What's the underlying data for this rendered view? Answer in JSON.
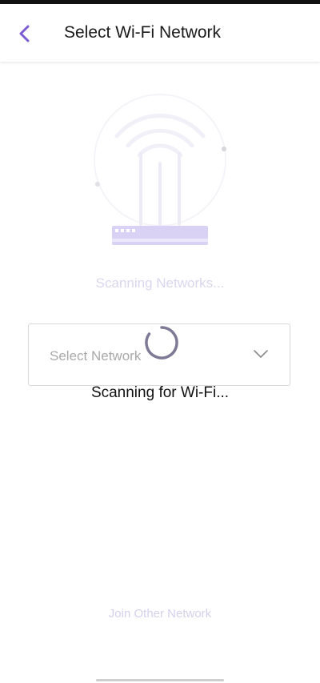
{
  "header": {
    "title": "Select Wi-Fi Network",
    "back_icon": "chevron-left-icon"
  },
  "illustration": {
    "icon": "wifi-router-icon"
  },
  "status": {
    "scanning_networks": "Scanning Networks...",
    "scanning_wifi": "Scanning for Wi-Fi..."
  },
  "network_select": {
    "placeholder": "Select Network",
    "dropdown_icon": "chevron-down-icon"
  },
  "footer": {
    "join_other": "Join Other Network"
  },
  "colors": {
    "accent": "#7b5bd1",
    "router_light": "#d9d2f5",
    "muted_text": "#dad6ee"
  }
}
